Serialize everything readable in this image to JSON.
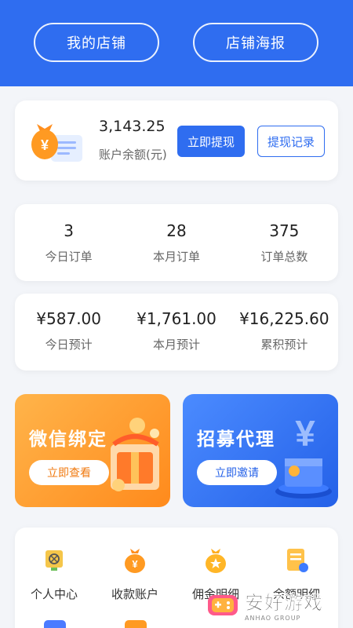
{
  "header": {
    "left_button": "我的店铺",
    "right_button": "店铺海报"
  },
  "balance": {
    "amount": "3,143.25",
    "label": "账户余额(元)",
    "withdraw": "立即提现",
    "records": "提现记录"
  },
  "orders": [
    {
      "value": "3",
      "label": "今日订单"
    },
    {
      "value": "28",
      "label": "本月订单"
    },
    {
      "value": "375",
      "label": "订单总数"
    }
  ],
  "estimates": [
    {
      "value": "¥587.00",
      "label": "今日预计"
    },
    {
      "value": "¥1,761.00",
      "label": "本月预计"
    },
    {
      "value": "¥16,225.60",
      "label": "累积预计"
    }
  ],
  "banners": [
    {
      "title": "微信绑定",
      "button": "立即查看",
      "color": "#ff8a1c"
    },
    {
      "title": "招募代理",
      "button": "立即邀请",
      "color": "#2461e8"
    }
  ],
  "menu": [
    {
      "label": "个人中心",
      "icon": "user-center-icon"
    },
    {
      "label": "收款账户",
      "icon": "money-bag-icon"
    },
    {
      "label": "佣金明细",
      "icon": "commission-icon"
    },
    {
      "label": "余额明细",
      "icon": "balance-detail-icon"
    }
  ],
  "watermark": {
    "name": "安好游戏",
    "sub": "ANHAO GROUP"
  },
  "colors": {
    "primary": "#2f6df0",
    "orange": "#ff8a1c"
  }
}
